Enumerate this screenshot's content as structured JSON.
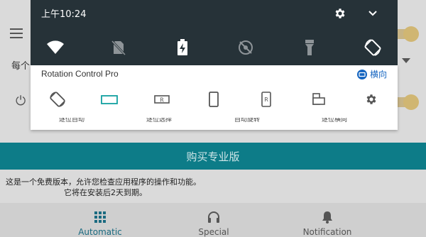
{
  "status_bar": {
    "time": "上午10:24"
  },
  "card": {
    "app_name": "Rotation Control Pro",
    "current_mode": "横向",
    "partial_labels": [
      "逐位自动",
      "逐位选择",
      "自动旋转",
      "逐位横向",
      "•"
    ]
  },
  "background": {
    "text_left": "每个",
    "buy_button": "购买专业版",
    "info_line1": "这是一个免费版本，允许您检查应用程序的操作和功能。",
    "info_line2": "它将在安装后2天到期。"
  },
  "bottom_nav": [
    {
      "label": "Automatic",
      "icon": "grid-icon",
      "active": true
    },
    {
      "label": "Special",
      "icon": "headphones-icon",
      "active": false
    },
    {
      "label": "Notification",
      "icon": "bell-icon",
      "active": false
    }
  ],
  "colors": {
    "accent": "#0d7c88",
    "shade": "#263238",
    "toggle": "#c99a1e",
    "mode_blue": "#1565c0"
  }
}
